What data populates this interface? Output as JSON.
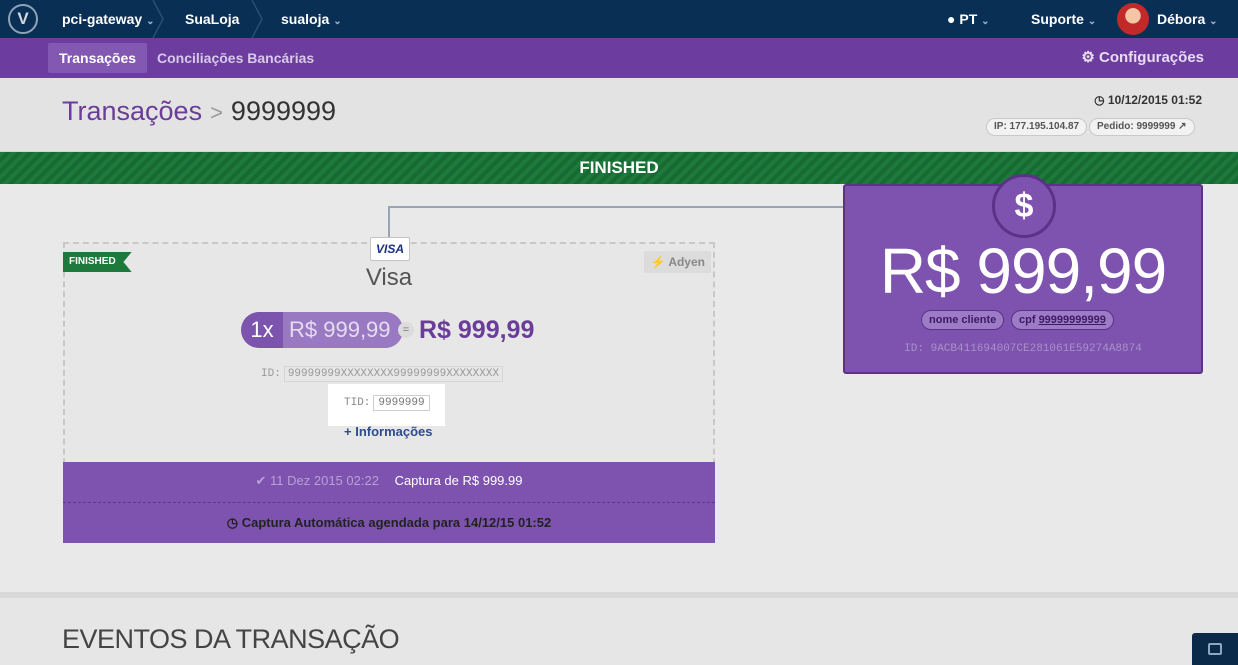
{
  "topnav": {
    "crumbs": [
      "pci-gateway",
      "SuaLoja",
      "sualoja"
    ],
    "lang": "PT",
    "support": "Suporte",
    "user": "Débora"
  },
  "subnav": {
    "tabs": [
      "Transações",
      "Conciliações Bancárias"
    ],
    "config": "Configurações"
  },
  "header": {
    "title": "Transações",
    "order_id": "9999999",
    "date": "10/12/2015 01:52",
    "ip": "IP: 177.195.104.87",
    "pedido": "Pedido: 9999999"
  },
  "status": "FINISHED",
  "card": {
    "ribbon": "FINISHED",
    "acquirer": "Adyen",
    "card_logo": "VISA",
    "brand": "Visa",
    "installments": "1x",
    "installment_value": "R$ 999,99",
    "equals": "=",
    "total": "R$ 999,99",
    "id_label": "ID:",
    "id_value": "99999999XXXXXXXX99999999XXXXXXXX",
    "tid_label": "TID:",
    "tid_value": "9999999",
    "info_link": "Informações",
    "capture_date": "11 Dez 2015 02:22",
    "capture_text": "Captura de R$ 999.99",
    "scheduled": "Captura Automática agendada para 14/12/15 01:52"
  },
  "value_box": {
    "symbol": "$",
    "amount": "R$ 999,99",
    "name_pill": "nome cliente",
    "cpf_label": "cpf",
    "cpf_value": "99999999999",
    "id_label": "ID:",
    "id_value": "9ACB411694007CE281061E59274A8874"
  },
  "events_title": "EVENTOS DA TRANSAÇÃO",
  "colors": {
    "navy": "#0a2f55",
    "purple": "#6c3d9e",
    "purple_light": "#7e53b0",
    "green": "#1e7a3c"
  },
  "icons": [
    "logo-icon",
    "chevron-down-icon",
    "globe-icon",
    "gear-icon",
    "clock-icon",
    "external-link-icon",
    "plug-icon",
    "dollar-icon",
    "check-icon",
    "plus-icon",
    "chat-icon"
  ]
}
